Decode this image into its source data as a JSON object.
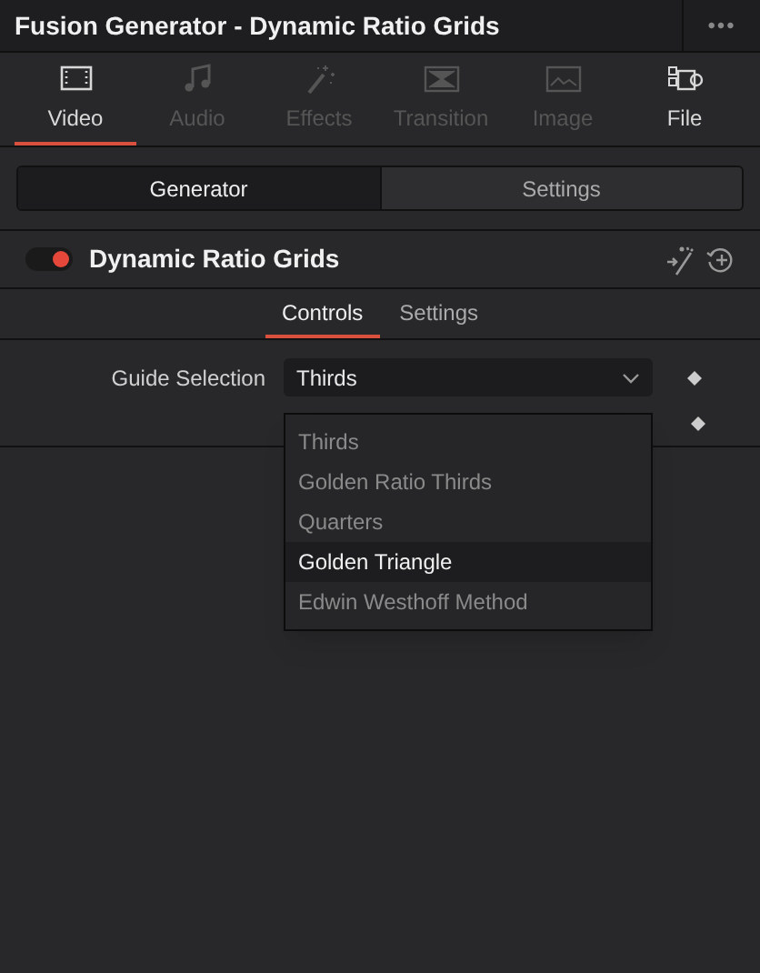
{
  "window": {
    "title": "Fusion Generator - Dynamic Ratio Grids",
    "menu": "•••"
  },
  "media_tabs": [
    {
      "label": "Video",
      "kind": "video",
      "selected": true,
      "disabled": false
    },
    {
      "label": "Audio",
      "kind": "audio",
      "selected": false,
      "disabled": true
    },
    {
      "label": "Effects",
      "kind": "effects",
      "selected": false,
      "disabled": true
    },
    {
      "label": "Transition",
      "kind": "transition",
      "selected": false,
      "disabled": true
    },
    {
      "label": "Image",
      "kind": "image",
      "selected": false,
      "disabled": true
    },
    {
      "label": "File",
      "kind": "file",
      "selected": false,
      "disabled": false
    }
  ],
  "segments": [
    {
      "label": "Generator",
      "selected": true
    },
    {
      "label": "Settings",
      "selected": false
    }
  ],
  "effect": {
    "name": "Dynamic Ratio Grids",
    "on": true
  },
  "sub_tabs": [
    {
      "label": "Controls",
      "selected": true
    },
    {
      "label": "Settings",
      "selected": false
    }
  ],
  "guide_selection": {
    "label": "Guide Selection",
    "value": "Thirds",
    "options": [
      {
        "label": "Thirds",
        "highlighted": false
      },
      {
        "label": "Golden Ratio Thirds",
        "highlighted": false
      },
      {
        "label": "Quarters",
        "highlighted": false
      },
      {
        "label": "Golden Triangle",
        "highlighted": true
      },
      {
        "label": "Edwin Westhoff Method",
        "highlighted": false
      }
    ]
  }
}
